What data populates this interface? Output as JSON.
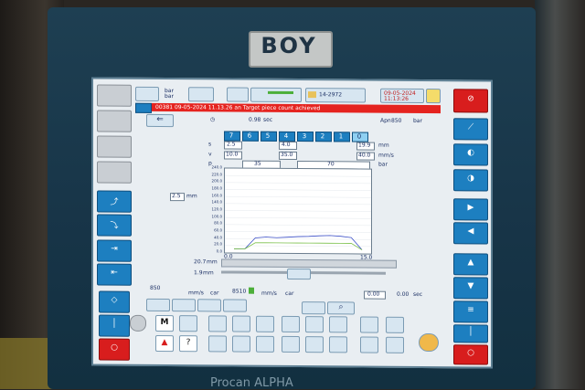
{
  "brand": {
    "logo": "BOY"
  },
  "caption": {
    "text": "Procan ALPHA"
  },
  "header": {
    "unit_bar_1": "bar",
    "unit_bar_2": "bar",
    "counter_value": "14-2972",
    "date_top": "09-05-2024",
    "time_top": "11:13:26"
  },
  "alarm": {
    "code": "00381",
    "text": "00381 09-05-2024 11.13.26 an Target piece count achieved",
    "color": "#e5231f"
  },
  "process": {
    "cycle_value": "0.98",
    "cycle_unit": "sec",
    "apn_label": "Apn",
    "apn_value": "850",
    "apn_unit": "bar",
    "stages": [
      "7",
      "6",
      "5",
      "4",
      "3",
      "2",
      "1",
      "0"
    ],
    "row_s_left": "2.5",
    "row_s_mid": "4.0",
    "row_s_right": "19.9",
    "row_s_unit": "mm",
    "row_v_left": "10.0",
    "row_v_mid": "35.0",
    "row_v_right": "40.0",
    "row_v_unit": "mm/s",
    "row_p_mid": "35",
    "row_p_right": "70",
    "row_p_unit": "bar",
    "left_value": "2.5",
    "left_unit": "mm",
    "pos_value": "20.7",
    "pos_unit": "mm",
    "stroke_value": "1.9",
    "stroke_unit": "mm",
    "bottom_left_value": "850",
    "bottom_mid_value": "8510",
    "unit_mm_s": "mm/s",
    "unit_car": "car",
    "time_a": "0.00",
    "time_b": "0.00",
    "time_unit": "sec",
    "mode_label": "M"
  },
  "chart_data": {
    "type": "line",
    "title": "",
    "y_ticks": [
      "240.0",
      "220.0",
      "200.0",
      "180.0",
      "160.0",
      "140.0",
      "120.0",
      "100.0",
      "80.0",
      "60.0",
      "40.0",
      "20.0",
      "0.0"
    ],
    "x_ticks": [
      "0.0",
      "15.0"
    ],
    "series": [
      {
        "values": [
          0,
          0,
          35,
          38,
          36,
          38,
          40,
          41,
          43,
          44,
          42,
          38,
          0
        ]
      },
      {
        "values": [
          0,
          0,
          20,
          20,
          20,
          20,
          20,
          20,
          20,
          20,
          20,
          20,
          0
        ]
      }
    ]
  },
  "colors": {
    "screen_bg": "#e9eef2",
    "button_blue": "#1d7fc0",
    "alarm_red": "#e5231f",
    "cabinet": "#173447"
  },
  "icons": [
    "stop-icon",
    "warning-icon",
    "help-icon",
    "home-icon",
    "screw-icon",
    "mold-icon"
  ]
}
